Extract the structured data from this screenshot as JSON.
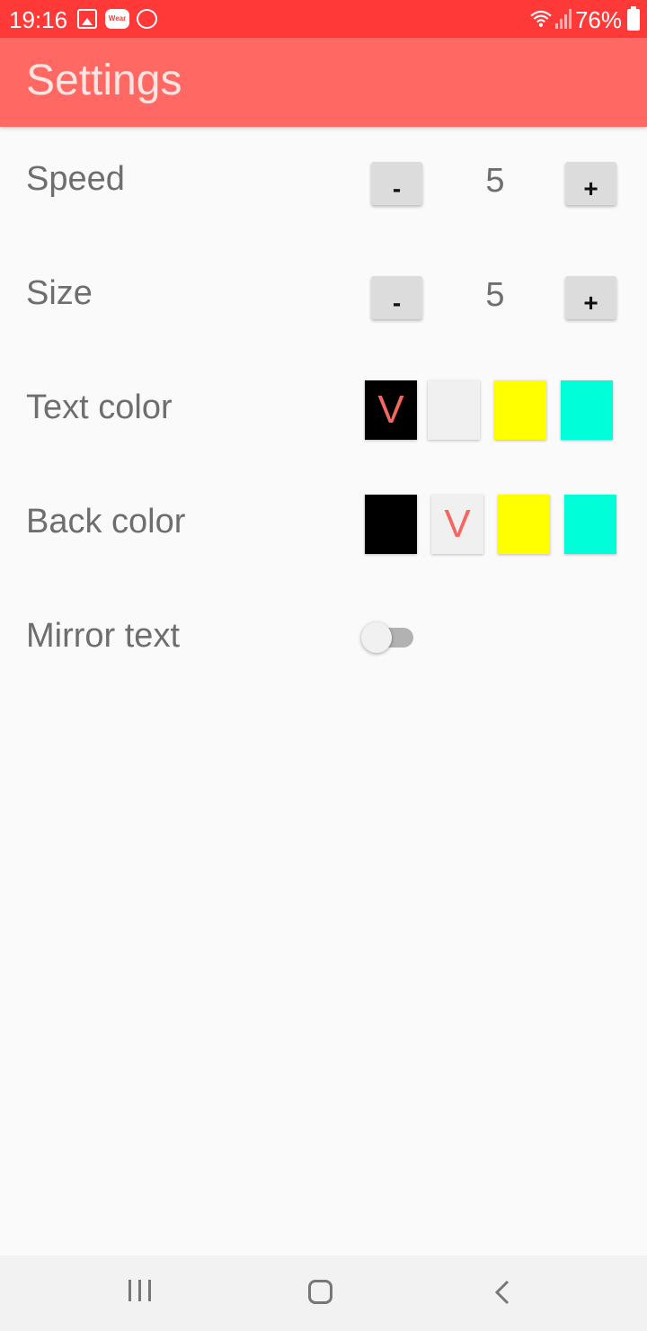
{
  "status_bar": {
    "time": "19:16",
    "wear_label": "Wear",
    "battery": "76%",
    "color": "#ff3838",
    "icons": [
      "gallery-icon",
      "wear-icon",
      "phone-icon",
      "wifi-icon",
      "signal-icon",
      "battery-icon"
    ]
  },
  "app_bar": {
    "title": "Settings",
    "color": "#ff6863"
  },
  "settings": {
    "speed": {
      "label": "Speed",
      "decrement": "-",
      "value": "5",
      "increment": "+"
    },
    "size": {
      "label": "Size",
      "decrement": "-",
      "value": "5",
      "increment": "+"
    },
    "text_color": {
      "label": "Text color",
      "options": [
        "#000000",
        "#f0f0f0",
        "#ffff00",
        "#00ffd9"
      ],
      "selected_index": 0,
      "selected_mark": "V"
    },
    "back_color": {
      "label": "Back color",
      "options": [
        "#000000",
        "#f0f0f0",
        "#ffff00",
        "#00ffd9"
      ],
      "selected_index": 1,
      "selected_mark": "V"
    },
    "mirror_text": {
      "label": "Mirror text",
      "enabled": false
    }
  },
  "nav_bar": {
    "icons": [
      "recent-apps-icon",
      "home-icon",
      "back-icon"
    ]
  }
}
